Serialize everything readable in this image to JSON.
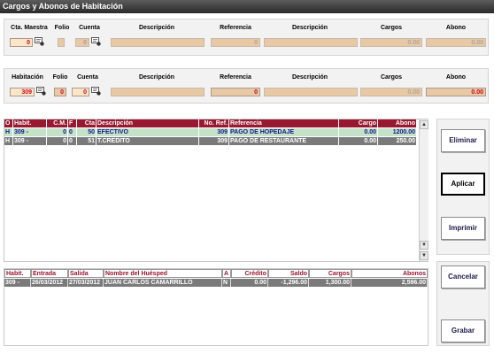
{
  "window": {
    "title": "Cargos y Abonos de Habitación"
  },
  "panel1": {
    "labels": {
      "cta_maestra": "Cta. Maestra",
      "folio": "Folio",
      "cuenta": "Cuenta",
      "descripcion1": "Descripción",
      "referencia": "Referencia",
      "descripcion2": "Descripción",
      "cargos": "Cargos",
      "abono": "Abono"
    },
    "values": {
      "cta_maestra": "0",
      "folio": "",
      "cuenta": "0",
      "descripcion1": "",
      "referencia": "0",
      "descripcion2": "",
      "cargos": "0.00",
      "abono": "0.00"
    }
  },
  "panel2": {
    "labels": {
      "habitacion": "Habitación",
      "folio": "Folio",
      "cuenta": "Cuenta",
      "descripcion1": "Descripción",
      "referencia": "Referencia",
      "descripcion2": "Descripción",
      "cargos": "Cargos",
      "abono": "Abono"
    },
    "values": {
      "habitacion": "309",
      "folio": "0",
      "cuenta": "0",
      "descripcion1": "",
      "referencia": "0",
      "descripcion2": "",
      "cargos": "0.00",
      "abono": "0.00"
    }
  },
  "movements": {
    "headers": [
      "O",
      "Habit.",
      "C.M.",
      "F",
      "Cta",
      "Descripción",
      "No. Ref.",
      "Referencia",
      "Cargo",
      "Abono"
    ],
    "rows": [
      [
        "H",
        "309",
        "-",
        "0",
        "0",
        "50",
        "EFECTIVO",
        "309",
        "PAGO DE HOPEDAJE",
        "0.00",
        "1200.00"
      ],
      [
        "H",
        "309",
        "-",
        "0",
        "0",
        "51",
        "T.CREDITO",
        "309",
        "PAGO DE RESTAURANTE",
        "0.00",
        "250.00"
      ]
    ]
  },
  "guests": {
    "headers": [
      "Habit.",
      "Entrada",
      "Salida",
      "Nombre del Huésped",
      "A",
      "Crédito",
      "Saldo",
      "Cargos",
      "Abonos"
    ],
    "rows": [
      [
        "309",
        "-",
        "26/03/2012",
        "27/03/2012",
        "JUAN CARLOS CAMARRILLO",
        "N",
        "0.00",
        "-1,296.00",
        "1,300.00",
        "2,596.00"
      ]
    ]
  },
  "buttons": {
    "eliminar": "Eliminar",
    "aplicar": "Aplicar",
    "imprimir": "Imprimir",
    "cancelar": "Cancelar",
    "grabar": "Grabar"
  },
  "colors": {
    "header_bg": "#97182f",
    "row_selected": "#c4e2c8",
    "row_normal": "#7a7a7a",
    "value_red": "#d0001c",
    "field_bg": "#e8c9a6"
  }
}
